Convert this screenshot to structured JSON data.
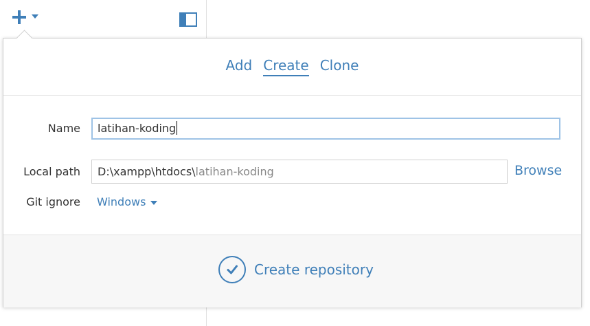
{
  "tabs": [
    {
      "label": "Add",
      "active": false
    },
    {
      "label": "Create",
      "active": true
    },
    {
      "label": "Clone",
      "active": false
    }
  ],
  "form": {
    "name_label": "Name",
    "name_value": "latihan-koding",
    "local_path_label": "Local path",
    "local_path_base": "D:\\xampp\\htdocs\\",
    "local_path_name": "latihan-koding",
    "browse_label": "Browse",
    "git_ignore_label": "Git ignore",
    "git_ignore_value": "Windows"
  },
  "footer": {
    "create_label": "Create repository"
  },
  "icons": {
    "add": "plus-icon",
    "add_menu": "chevron-down-icon",
    "panel": "sidebar-toggle-icon",
    "create": "checkmark-circle-icon"
  },
  "colors": {
    "accent": "#3f7fb8",
    "focus_border": "#9ec3e6",
    "footer_bg": "#f7f7f7"
  }
}
